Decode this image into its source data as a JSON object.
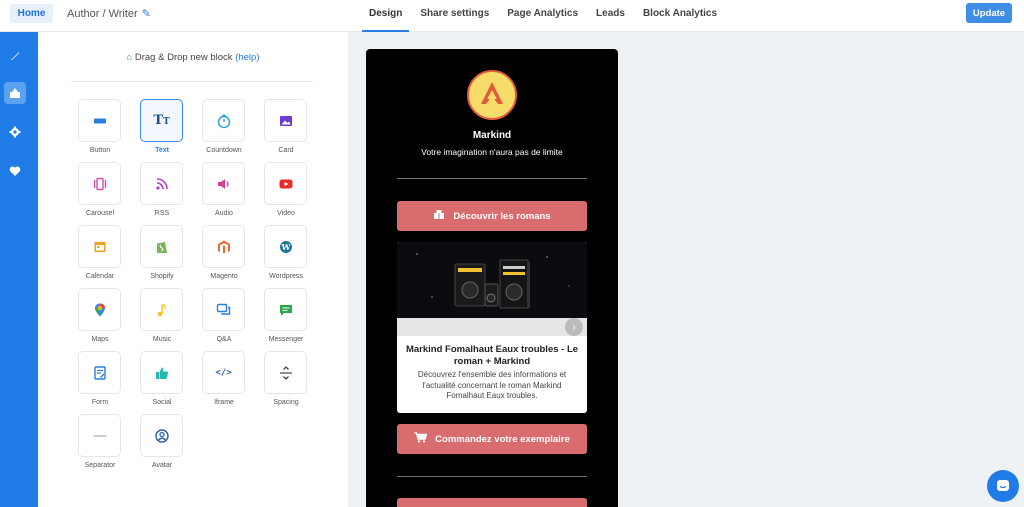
{
  "topbar": {
    "home": "Home",
    "page_name": "Author / Writer",
    "tabs": [
      "Design",
      "Share settings",
      "Page Analytics",
      "Leads",
      "Block Analytics"
    ],
    "update": "Update"
  },
  "rail": {
    "items": [
      {
        "icon": "brush-icon",
        "active": false
      },
      {
        "icon": "blocks-icon",
        "active": true
      },
      {
        "icon": "gear-icon",
        "active": false
      },
      {
        "icon": "heart-icon",
        "active": false
      }
    ]
  },
  "panel": {
    "title": "Drag & Drop new block",
    "help": "(help)",
    "blocks": [
      {
        "label": "Button",
        "icon": "button-icon",
        "color": "#2a7de1"
      },
      {
        "label": "Text",
        "icon": "text-icon",
        "color": "#1e4f8f",
        "selected": true
      },
      {
        "label": "Countdown",
        "icon": "stopwatch-icon",
        "color": "#2a9fd6"
      },
      {
        "label": "Card",
        "icon": "image-icon",
        "color": "#6a3fd0"
      },
      {
        "label": "Carousel",
        "icon": "carousel-icon",
        "color": "#d64bb5"
      },
      {
        "label": "RSS",
        "icon": "rss-icon",
        "color": "#b43fd0"
      },
      {
        "label": "Audio",
        "icon": "speaker-icon",
        "color": "#d63f8f"
      },
      {
        "label": "Video",
        "icon": "youtube-icon",
        "color": "#e52d27"
      },
      {
        "label": "Calendar",
        "icon": "calendar-icon",
        "color": "#f0a020"
      },
      {
        "label": "Shopify",
        "icon": "shopify-icon",
        "color": "#7ab55c"
      },
      {
        "label": "Magento",
        "icon": "magento-icon",
        "color": "#ee672f"
      },
      {
        "label": "Wordpress",
        "icon": "wordpress-icon",
        "color": "#21759b"
      },
      {
        "label": "Maps",
        "icon": "maps-pin-icon",
        "color": "#34a853"
      },
      {
        "label": "Music",
        "icon": "music-note-icon",
        "color": "#f0c419"
      },
      {
        "label": "Q&A",
        "icon": "chat-bubbles-icon",
        "color": "#2a7de1"
      },
      {
        "label": "Messenger",
        "icon": "message-icon",
        "color": "#2ea64d"
      },
      {
        "label": "Form",
        "icon": "form-icon",
        "color": "#2a7de1"
      },
      {
        "label": "Social",
        "icon": "thumbs-up-icon",
        "color": "#22b8b0"
      },
      {
        "label": "Iframe",
        "icon": "code-icon",
        "color": "#2a5fa8"
      },
      {
        "label": "Spacing",
        "icon": "spacing-icon",
        "color": "#444444"
      },
      {
        "label": "Separator",
        "icon": "separator-icon",
        "color": "#999999"
      },
      {
        "label": "Avatar",
        "icon": "avatar-icon",
        "color": "#2a5fa8"
      }
    ]
  },
  "preview": {
    "brand": "Markind",
    "tagline": "Votre imagination n'aura pas de limite",
    "cta1": "Découvrir les romans",
    "card_title": "Markind Fomalhaut Eaux troubles - Le roman + Markind",
    "card_desc": "Découvrez l'ensemble des informations et l'actualité concernant le roman Markind Fomalhaut Eaux troubles.",
    "cta2": "Commandez votre exemplaire"
  },
  "colors": {
    "accent": "#1f7ce6",
    "cta": "#d96c6f",
    "canvas": "#eef2f5"
  }
}
